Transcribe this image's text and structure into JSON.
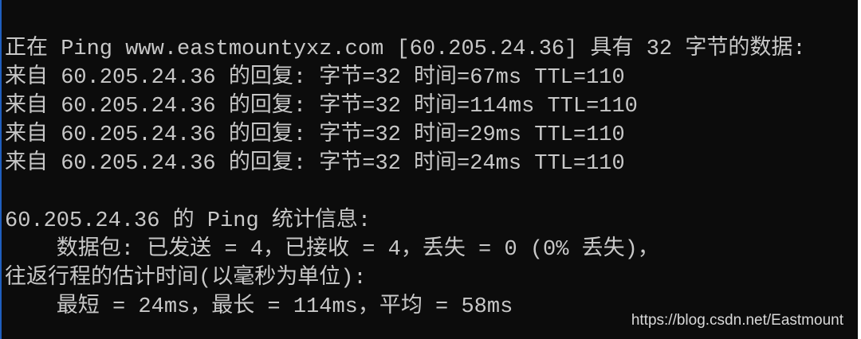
{
  "terminal": {
    "lines": [
      "正在 Ping www.eastmountyxz.com [60.205.24.36] 具有 32 字节的数据:",
      "来自 60.205.24.36 的回复: 字节=32 时间=67ms TTL=110",
      "来自 60.205.24.36 的回复: 字节=32 时间=114ms TTL=110",
      "来自 60.205.24.36 的回复: 字节=32 时间=29ms TTL=110",
      "来自 60.205.24.36 的回复: 字节=32 时间=24ms TTL=110",
      "",
      "60.205.24.36 的 Ping 统计信息:",
      "    数据包: 已发送 = 4，已接收 = 4，丢失 = 0 (0% 丢失)，",
      "往返行程的估计时间(以毫秒为单位):",
      "    最短 = 24ms，最长 = 114ms，平均 = 58ms"
    ]
  },
  "watermark": "https://blog.csdn.net/Eastmount"
}
